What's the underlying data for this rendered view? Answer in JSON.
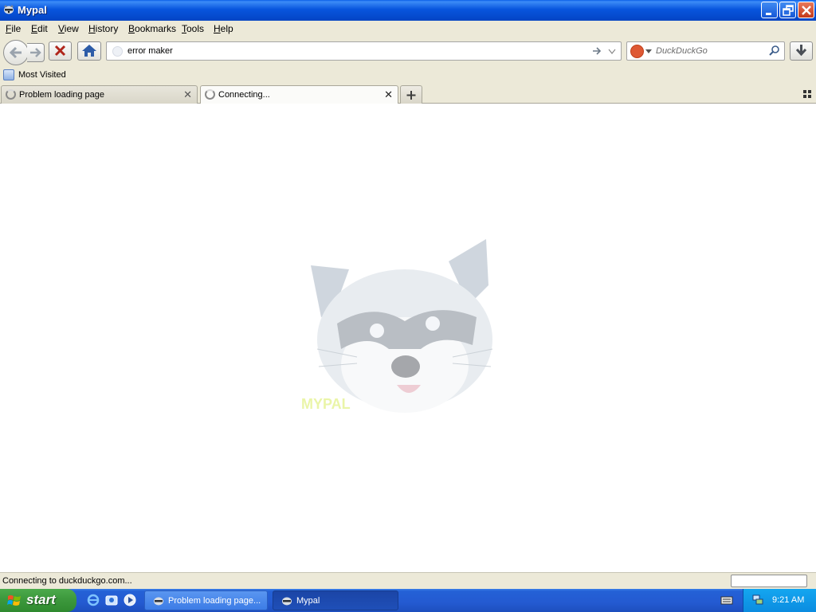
{
  "window": {
    "title": "Mypal"
  },
  "menu": [
    "File",
    "Edit",
    "View",
    "History",
    "Bookmarks",
    "Tools",
    "Help"
  ],
  "menu_access_keys": [
    "F",
    "E",
    "V",
    "H",
    "B",
    "T",
    "H"
  ],
  "navbar": {
    "url": "error maker",
    "search_placeholder": "DuckDuckGo"
  },
  "bookmarks": {
    "most_visited": "Most Visited"
  },
  "tabs": [
    {
      "label": "Problem loading page",
      "state": "loading"
    },
    {
      "label": "Connecting...",
      "state": "loading",
      "active": true
    }
  ],
  "content": {
    "mascot": "raccoon-logo",
    "mascot_caption": "MYPAL"
  },
  "status": {
    "text": "Connecting to duckduckgo.com..."
  },
  "taskbar": {
    "start_label": "start",
    "tasks": [
      {
        "label": "Problem loading page...",
        "active": false
      },
      {
        "label": "Mypal",
        "active": true
      }
    ],
    "clock": "9:21 AM"
  },
  "colors": {
    "titlebar": "#0855dd",
    "taskbar": "#245ad1",
    "start": "#3e9a3e",
    "tray": "#0b8ce0",
    "chrome": "#ece9d8"
  }
}
